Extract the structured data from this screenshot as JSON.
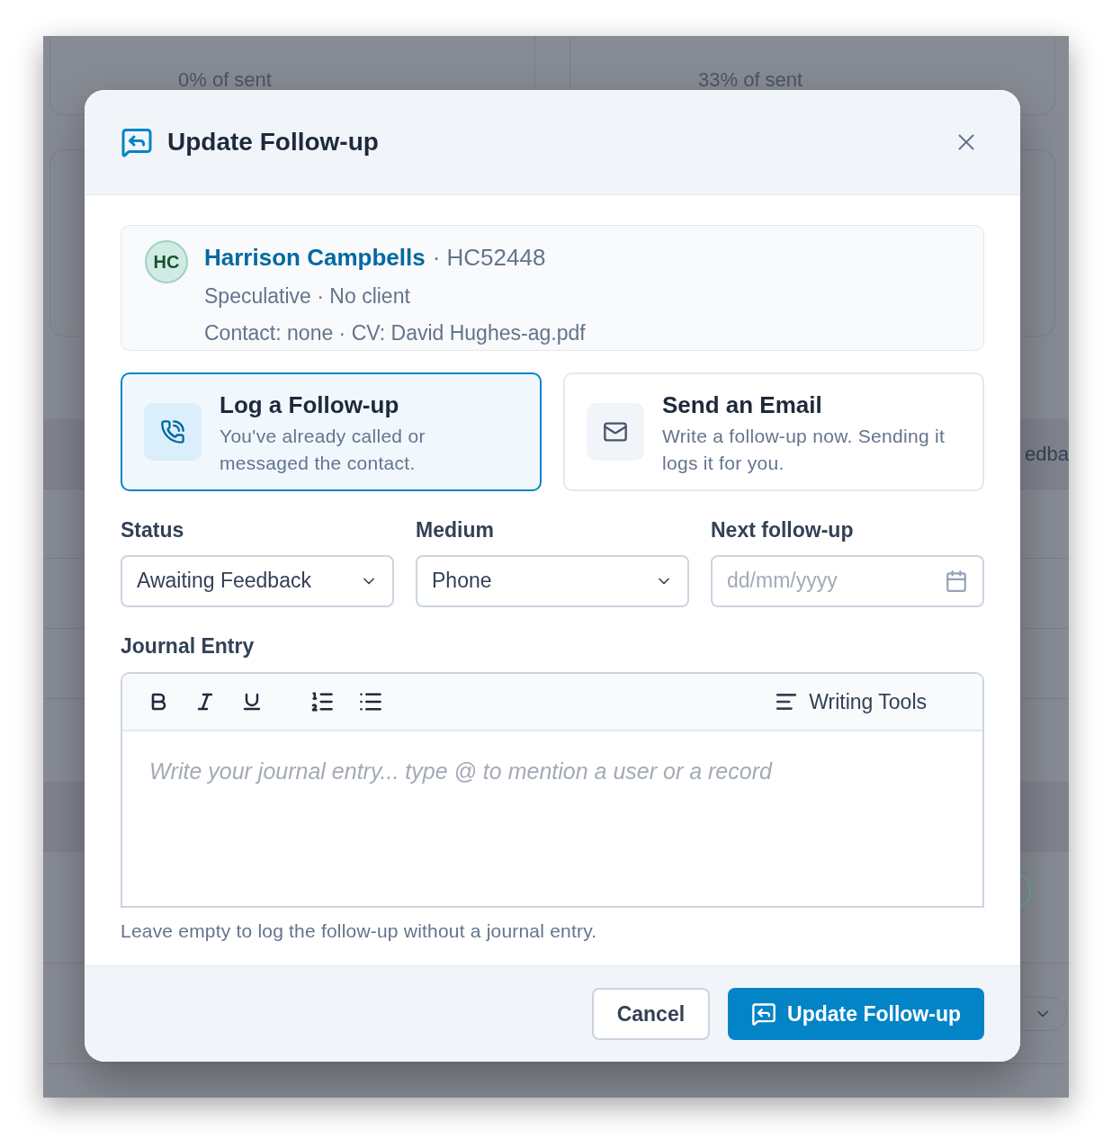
{
  "background": {
    "cards": [
      {
        "caption": "0% of sent"
      },
      {
        "caption": "33% of sent"
      }
    ],
    "table_cell": "edba"
  },
  "dialog": {
    "title": "Update Follow-up",
    "contact": {
      "initials": "HC",
      "name": "Harrison Campbells",
      "reference": "· HC52448",
      "line_2": "Speculative · No client",
      "line_3": "Contact: none · CV: David Hughes-ag.pdf"
    },
    "options": [
      {
        "kind": "phone",
        "title": "Log a Follow-up",
        "description": "You've already called or messaged the contact.",
        "selected": true
      },
      {
        "kind": "email",
        "title": "Send an Email",
        "description": "Write a follow-up now. Sending it logs it for you.",
        "selected": false
      }
    ],
    "fields": [
      {
        "kind": "select",
        "label": "Status",
        "value": "Awaiting Feedback"
      },
      {
        "kind": "select",
        "label": "Medium",
        "value": "Phone"
      },
      {
        "kind": "date",
        "label": "Next follow-up",
        "placeholder": "dd/mm/yyyy"
      }
    ],
    "journal": {
      "label": "Journal Entry",
      "writing_tools": "Writing Tools",
      "placeholder": "Write your journal entry... type @ to mention a user or a record",
      "hint": "Leave empty to log the follow-up without a journal entry."
    },
    "buttons": {
      "cancel": "Cancel",
      "submit": "Update Follow-up"
    }
  }
}
